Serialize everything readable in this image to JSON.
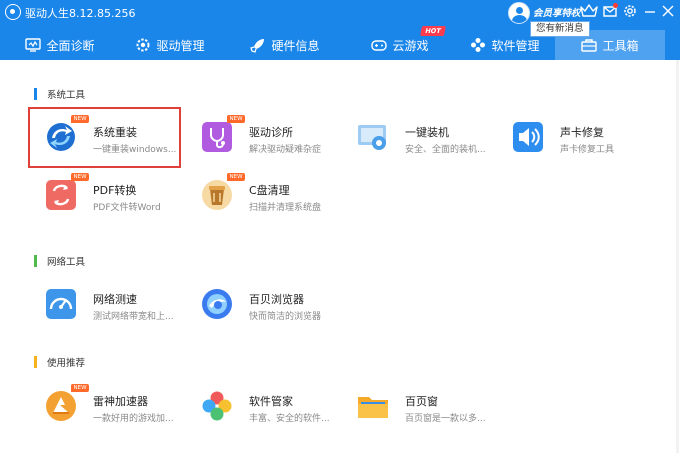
{
  "window": {
    "title": "驱动人生8.12.85.256",
    "vip_label": "会员享特权",
    "tooltip": "您有新消息"
  },
  "nav": {
    "tabs": [
      {
        "label": "全面诊断",
        "icon": "monitor-icon"
      },
      {
        "label": "驱动管理",
        "icon": "gear-icon"
      },
      {
        "label": "硬件信息",
        "icon": "rocket-icon"
      },
      {
        "label": "云游戏",
        "icon": "gamepad-icon"
      },
      {
        "label": "软件管理",
        "icon": "apps-icon"
      },
      {
        "label": "工具箱",
        "icon": "toolbox-icon",
        "active": true
      }
    ],
    "hot_badge": "HOT"
  },
  "new_badge": "NEW",
  "sections": {
    "system": {
      "title": "系统工具",
      "tools": [
        {
          "name": "系统重装",
          "desc": "一键重装windows...",
          "icon": "reinstall-icon",
          "new": true
        },
        {
          "name": "驱动诊所",
          "desc": "解决驱动疑难杂症",
          "icon": "driver-clinic-icon",
          "new": true
        },
        {
          "name": "一键装机",
          "desc": "安全、全面的装机...",
          "icon": "one-click-install-icon",
          "new": false
        },
        {
          "name": "声卡修复",
          "desc": "声卡修复工具",
          "icon": "speaker-icon",
          "new": false
        },
        {
          "name": "PDF转换",
          "desc": "PDF文件转Word",
          "icon": "pdf-convert-icon",
          "new": true
        },
        {
          "name": "C盘清理",
          "desc": "扫描并清理系统盘",
          "icon": "disk-clean-icon",
          "new": true
        }
      ]
    },
    "network": {
      "title": "网络工具",
      "tools": [
        {
          "name": "网络测速",
          "desc": "测试网络带宽和上...",
          "icon": "speedometer-icon",
          "new": false
        },
        {
          "name": "百贝浏览器",
          "desc": "快而简洁的浏览器",
          "icon": "browser-icon",
          "new": false
        }
      ]
    },
    "recommend": {
      "title": "使用推荐",
      "tools": [
        {
          "name": "雷神加速器",
          "desc": "一款好用的游戏加...",
          "icon": "accelerator-icon",
          "new": true
        },
        {
          "name": "软件管家",
          "desc": "丰富、安全的软件...",
          "icon": "software-manager-icon",
          "new": false
        },
        {
          "name": "百页窗",
          "desc": "百页窗是一款以多...",
          "icon": "folder-icon",
          "new": false
        }
      ]
    }
  },
  "colors": {
    "header": "#1b86ea",
    "active_tab": "#4ea2f0",
    "highlight": "#e0403a",
    "new_badge": "#ff6a2a"
  }
}
